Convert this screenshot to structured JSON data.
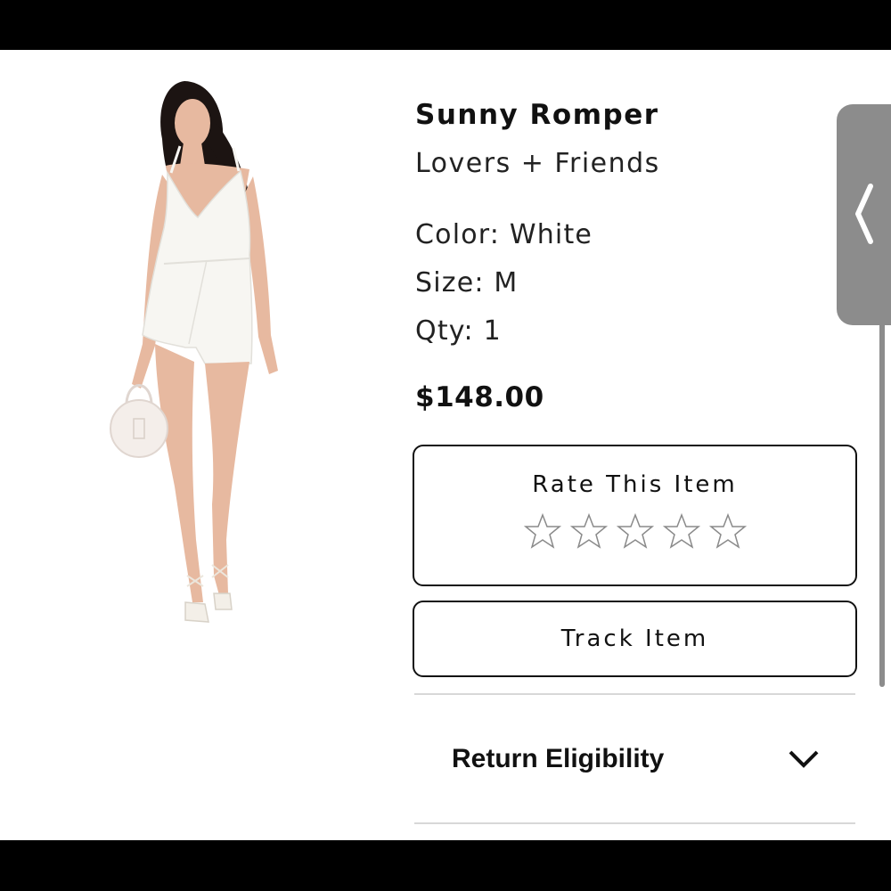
{
  "product": {
    "name": "Sunny Romper",
    "brand": "Lovers + Friends",
    "color_line": "Color: White",
    "size_line": "Size: M",
    "qty_line": "Qty: 1",
    "price": "$148.00"
  },
  "rating": {
    "title": "Rate This Item",
    "stars_filled": 0,
    "stars_total": 5,
    "star_icon": "star-outline-icon"
  },
  "track": {
    "label": "Track Item"
  },
  "returns": {
    "label": "Return Eligibility",
    "icon": "chevron-down-icon"
  },
  "side_handle": {
    "icon": "chevron-left-icon"
  },
  "colors": {
    "text": "#111111",
    "border": "#111111",
    "divider": "#d8d8d8",
    "handle": "#8c8c8c",
    "star_stroke": "#8a8a8a",
    "dress": "#f7f6f2",
    "skin": "#e7b9a0",
    "hair": "#1c1412"
  }
}
